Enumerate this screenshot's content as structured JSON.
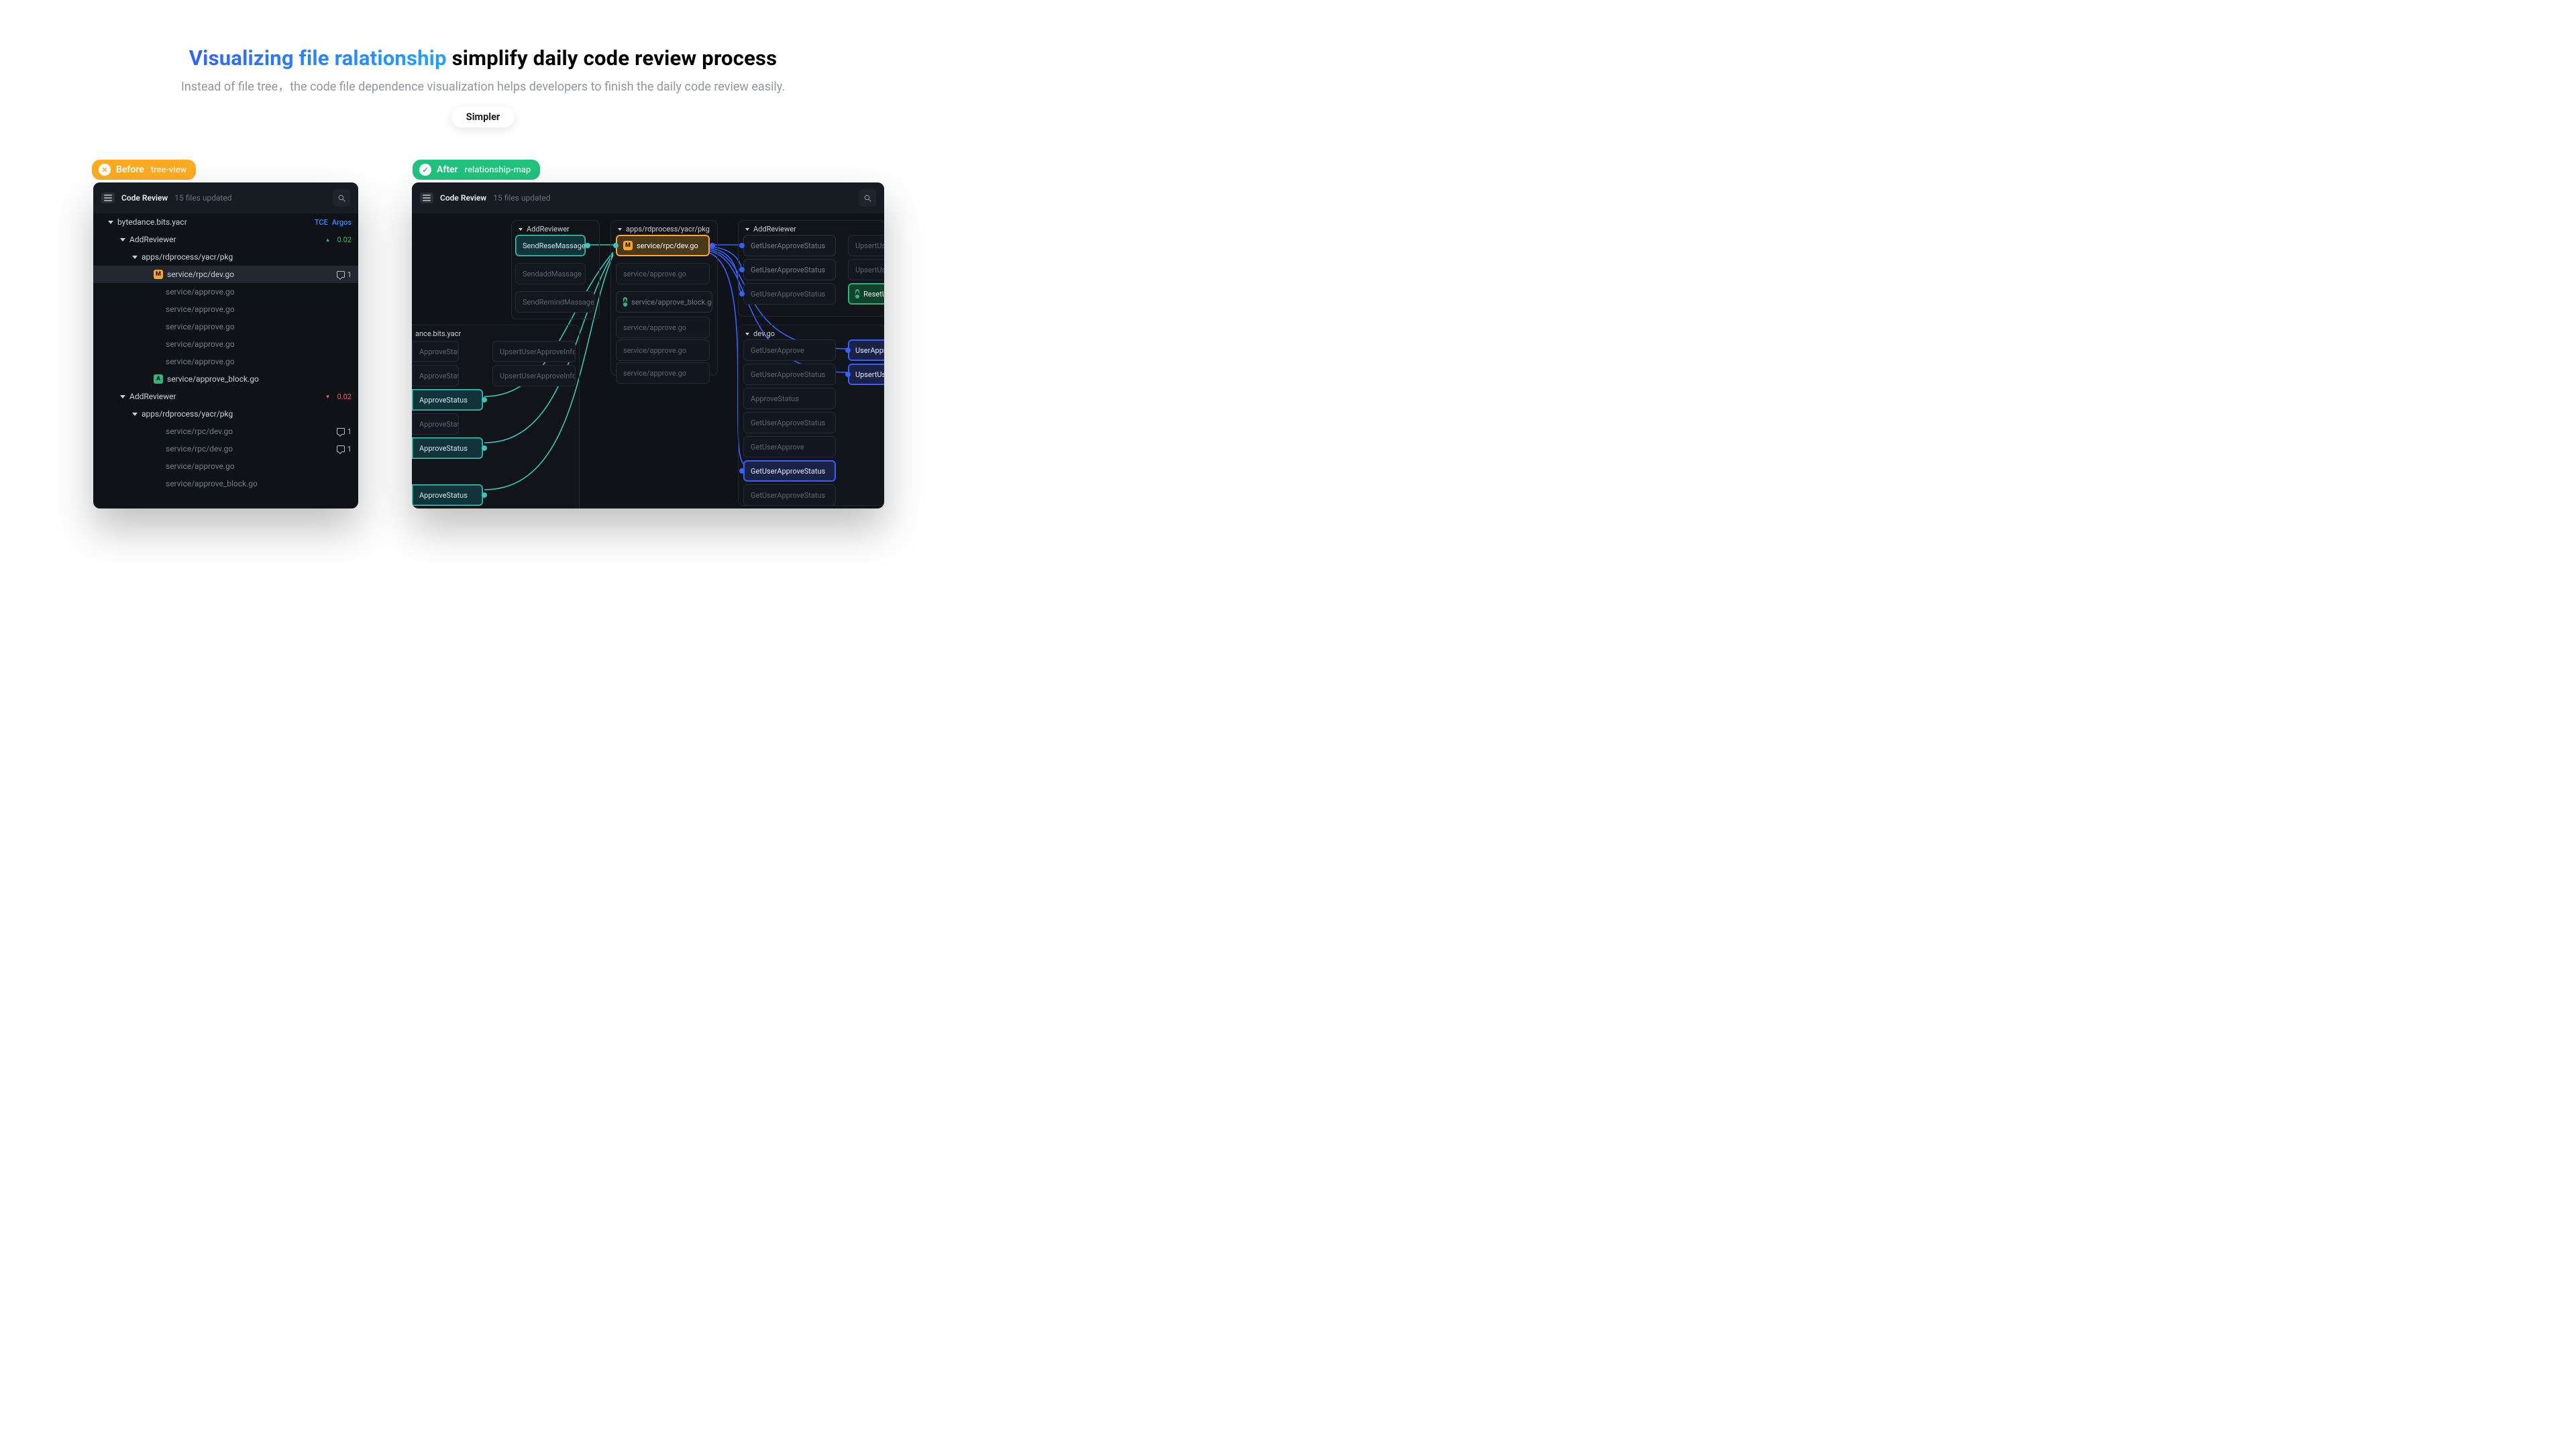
{
  "hero": {
    "title_gradient": "Visualizing file ralationship",
    "title_rest": " simplify daily code review process",
    "subtitle": "Instead of file tree，the code file dependence visualization helps developers to finish the daily code review easily.",
    "pill": "Simpler"
  },
  "badges": {
    "before_label": "Before",
    "before_sub": "tree-view",
    "after_label": "After",
    "after_sub": "relationship-map"
  },
  "panel": {
    "title": "Code Review",
    "subtitle": "15 files updated"
  },
  "tree": {
    "root": "bytedance.bits.yacr",
    "root_links": {
      "a": "TCE",
      "b": "Argos"
    },
    "group1": {
      "name": "AddReviewer",
      "delta": "0.02",
      "pkg": "apps/rdprocess/yacr/pkg",
      "items": [
        {
          "file": "service/rpc/dev.go",
          "tag": "M",
          "comments": "1",
          "selected": true
        },
        {
          "file": "service/approve.go"
        },
        {
          "file": "service/approve.go"
        },
        {
          "file": "service/approve.go"
        },
        {
          "file": "service/approve.go"
        },
        {
          "file": "service/approve.go"
        },
        {
          "file": "service/approve_block.go",
          "tag": "A"
        }
      ]
    },
    "group2": {
      "name": "AddReviewer",
      "delta": "0.02",
      "pkg": "apps/rdprocess/yacr/pkg",
      "items": [
        {
          "file": "service/rpc/dev.go",
          "comments": "1"
        },
        {
          "file": "service/rpc/dev.go",
          "comments": "1"
        },
        {
          "file": "service/approve.go"
        },
        {
          "file": "service/approve_block.go"
        }
      ]
    }
  },
  "map": {
    "clusters": {
      "addReviewerA": "AddReviewer",
      "pkg": "apps/rdprocess/yacr/pkg",
      "addReviewerB": "AddReviewer",
      "devgo": "dev.go",
      "partial_left_title": "ance.bits.yacr"
    },
    "nodes": {
      "sendRese": "SendReseMassage",
      "sendAdd": "SendaddMassage",
      "sendRemind": "SendRemindMassage",
      "rpcDev": "service/rpc/dev.go",
      "svcApprove": "service/approve.go",
      "svcApproveBlock": "service/approve_block.go",
      "getUserApproveStatus": "GetUserApproveStatus",
      "upsertUserA": "UpsertUserA",
      "resetUs": "ResetUs",
      "approveStatus": "ApproveStatus",
      "getUserApprove": "GetUserApprove",
      "userApprove": "UserApprove",
      "upsertUserApproveInfo": "UpsertUserApproveInfo"
    }
  }
}
